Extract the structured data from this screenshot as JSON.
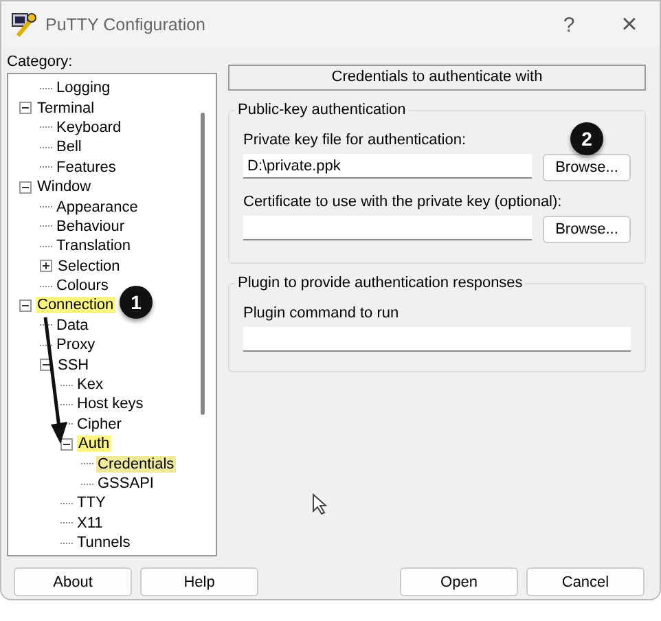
{
  "window": {
    "title": "PuTTY Configuration",
    "help_button": "?",
    "close_button": "×"
  },
  "category_label": "Category:",
  "tree": {
    "continued_children": [
      {
        "label": "Logging",
        "selected": false,
        "highlighted": false
      }
    ],
    "items": [
      {
        "label": "Terminal",
        "selected": false,
        "highlighted": false,
        "expanded": true,
        "children": [
          {
            "label": "Keyboard",
            "selected": false,
            "highlighted": false
          },
          {
            "label": "Bell",
            "selected": false,
            "highlighted": false
          },
          {
            "label": "Features",
            "selected": false,
            "highlighted": false
          }
        ]
      },
      {
        "label": "Window",
        "selected": false,
        "highlighted": false,
        "expanded": true,
        "children": [
          {
            "label": "Appearance",
            "selected": false,
            "highlighted": false
          },
          {
            "label": "Behaviour",
            "selected": false,
            "highlighted": false
          },
          {
            "label": "Translation",
            "selected": false,
            "highlighted": false
          },
          {
            "label": "Selection",
            "selected": false,
            "highlighted": false,
            "expanded": false
          },
          {
            "label": "Colours",
            "selected": false,
            "highlighted": false
          }
        ]
      },
      {
        "label": "Connection",
        "selected": false,
        "highlighted": true,
        "expanded": true,
        "children": [
          {
            "label": "Data",
            "selected": false,
            "highlighted": false
          },
          {
            "label": "Proxy",
            "selected": false,
            "highlighted": false
          },
          {
            "label": "SSH",
            "selected": false,
            "highlighted": false,
            "expanded": true,
            "children": [
              {
                "label": "Kex",
                "selected": false,
                "highlighted": false
              },
              {
                "label": "Host keys",
                "selected": false,
                "highlighted": false
              },
              {
                "label": "Cipher",
                "selected": false,
                "highlighted": false
              },
              {
                "label": "Auth",
                "selected": false,
                "highlighted": true,
                "expanded": true,
                "children": [
                  {
                    "label": "Credentials",
                    "selected": true,
                    "highlighted": true
                  },
                  {
                    "label": "GSSAPI",
                    "selected": false,
                    "highlighted": false
                  }
                ]
              },
              {
                "label": "TTY",
                "selected": false,
                "highlighted": false
              },
              {
                "label": "X11",
                "selected": false,
                "highlighted": false
              },
              {
                "label": "Tunnels",
                "selected": false,
                "highlighted": false
              }
            ]
          }
        ]
      }
    ]
  },
  "panel": {
    "heading": "Credentials to authenticate with",
    "groups": [
      {
        "title": "Public-key authentication",
        "fields": [
          {
            "label": "Private key file for authentication:",
            "value": "D:\\private.ppk",
            "button": "Browse..."
          },
          {
            "label": "Certificate to use with the private key (optional):",
            "button": "Browse..."
          }
        ]
      },
      {
        "title": "Plugin to provide authentication responses",
        "fields": [
          {
            "label": "Plugin command to run"
          }
        ]
      }
    ]
  },
  "callouts": [
    "1",
    "2"
  ],
  "buttons": {
    "left": [
      "About",
      "Help"
    ],
    "right": [
      "Open",
      "Cancel"
    ]
  }
}
